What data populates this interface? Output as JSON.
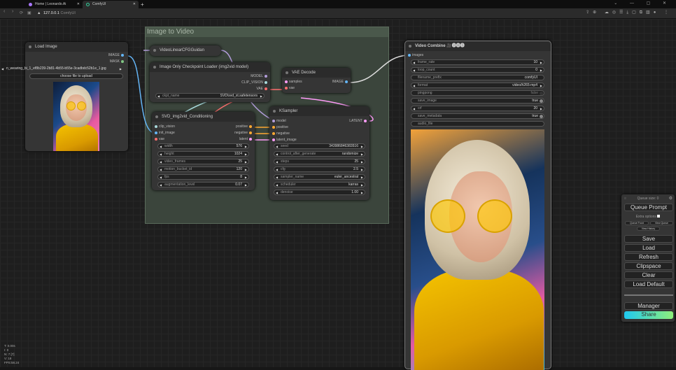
{
  "browser": {
    "tabs": [
      {
        "label": "Home | Leonardo.Ai"
      },
      {
        "label": "ComfyUI"
      }
    ],
    "new_tab": "+",
    "url_host": "127.0.0.1",
    "url_path": "ComfyUI"
  },
  "group": {
    "title": "Image to Video"
  },
  "load_image": {
    "title": "Load Image",
    "outputs": [
      "IMAGE",
      "MASK"
    ],
    "image_value": "n_wearing_bi_1_ef8b239-2b81-4b55-b55e-3cadbdc52b1e_1.jpg",
    "upload_label": "choose file to upload"
  },
  "guidance": {
    "title": "VideoLinearCFGGuidan"
  },
  "checkpoint": {
    "title": "Image Only Checkpoint Loader (img2vid model)",
    "outputs": [
      "MODEL",
      "CLIP_VISION",
      "VAE"
    ],
    "widgets": [
      {
        "label": "ckpt_name",
        "value": "SVD\\svd_xt.safetensors"
      }
    ]
  },
  "vae_decode": {
    "title": "VAE Decode",
    "inputs": [
      "samples",
      "vae"
    ],
    "outputs": [
      "IMAGE"
    ]
  },
  "conditioning": {
    "title": "SVD_img2vid_Conditioning",
    "inputs": [
      "clip_vision",
      "init_image",
      "vae"
    ],
    "outputs": [
      "positive",
      "negative",
      "latent"
    ],
    "widgets": [
      {
        "label": "width",
        "value": "576"
      },
      {
        "label": "height",
        "value": "1024"
      },
      {
        "label": "video_frames",
        "value": "25"
      },
      {
        "label": "motion_bucket_id",
        "value": "120"
      },
      {
        "label": "fps",
        "value": "8"
      },
      {
        "label": "augmentation_level",
        "value": "0.07"
      }
    ]
  },
  "ksampler": {
    "title": "KSampler",
    "inputs": [
      "model",
      "positive",
      "negative",
      "latent_image"
    ],
    "outputs": [
      "LATENT"
    ],
    "widgets": [
      {
        "label": "seed",
        "value": "343986846383516"
      },
      {
        "label": "control_after_generate",
        "value": "randomize"
      },
      {
        "label": "steps",
        "value": "25"
      },
      {
        "label": "cfg",
        "value": "2.5"
      },
      {
        "label": "sampler_name",
        "value": "euler_ancestral"
      },
      {
        "label": "scheduler",
        "value": "karras"
      },
      {
        "label": "denoise",
        "value": "1.00"
      }
    ]
  },
  "video_combine": {
    "title": "Video Combine",
    "badge": "🎥🅥🅗🅢",
    "inputs": [
      "images"
    ],
    "widgets": [
      {
        "label": "frame_rate",
        "value": "10",
        "kind": "number"
      },
      {
        "label": "loop_count",
        "value": "0",
        "kind": "number"
      },
      {
        "label": "filename_prefix",
        "value": "comfyUI",
        "kind": "text"
      },
      {
        "label": "format",
        "value": "video/h265-mp4",
        "kind": "combo"
      },
      {
        "label": "pingpong",
        "value": "false",
        "kind": "toggle-off"
      },
      {
        "label": "save_image",
        "value": "true",
        "kind": "toggle"
      },
      {
        "label": "crf",
        "value": "20",
        "kind": "number"
      },
      {
        "label": "save_metadata",
        "value": "true",
        "kind": "toggle"
      },
      {
        "label": "audio_file",
        "value": "",
        "kind": "text"
      }
    ]
  },
  "queue_panel": {
    "queue_size": "Queue size: 0",
    "queue_prompt": "Queue Prompt",
    "extra_options": "Extra options",
    "queue_front": "Queue Front",
    "view_queue": "View Queue",
    "view_history": "View History",
    "buttons": [
      "Save",
      "Load",
      "Refresh",
      "Clipspace",
      "Clear",
      "Load Default"
    ],
    "manager": "Manager",
    "share": "Share"
  },
  "stats": [
    "T: 0.00s",
    "I: 0",
    "N: 7 [7]",
    "V: 18",
    "FPS:58.24"
  ],
  "colors": {
    "accent_share_start": "#1fc8f0",
    "accent_share_end": "#8ef07a",
    "group_bg": "#3b453c",
    "link_image": "#64b5f6",
    "link_latent": "#ff9cf9",
    "link_vae": "#ff6e6e",
    "link_cond": "#ffa931",
    "link_clip": "#a8dadc",
    "link_model": "#b39ddb"
  }
}
